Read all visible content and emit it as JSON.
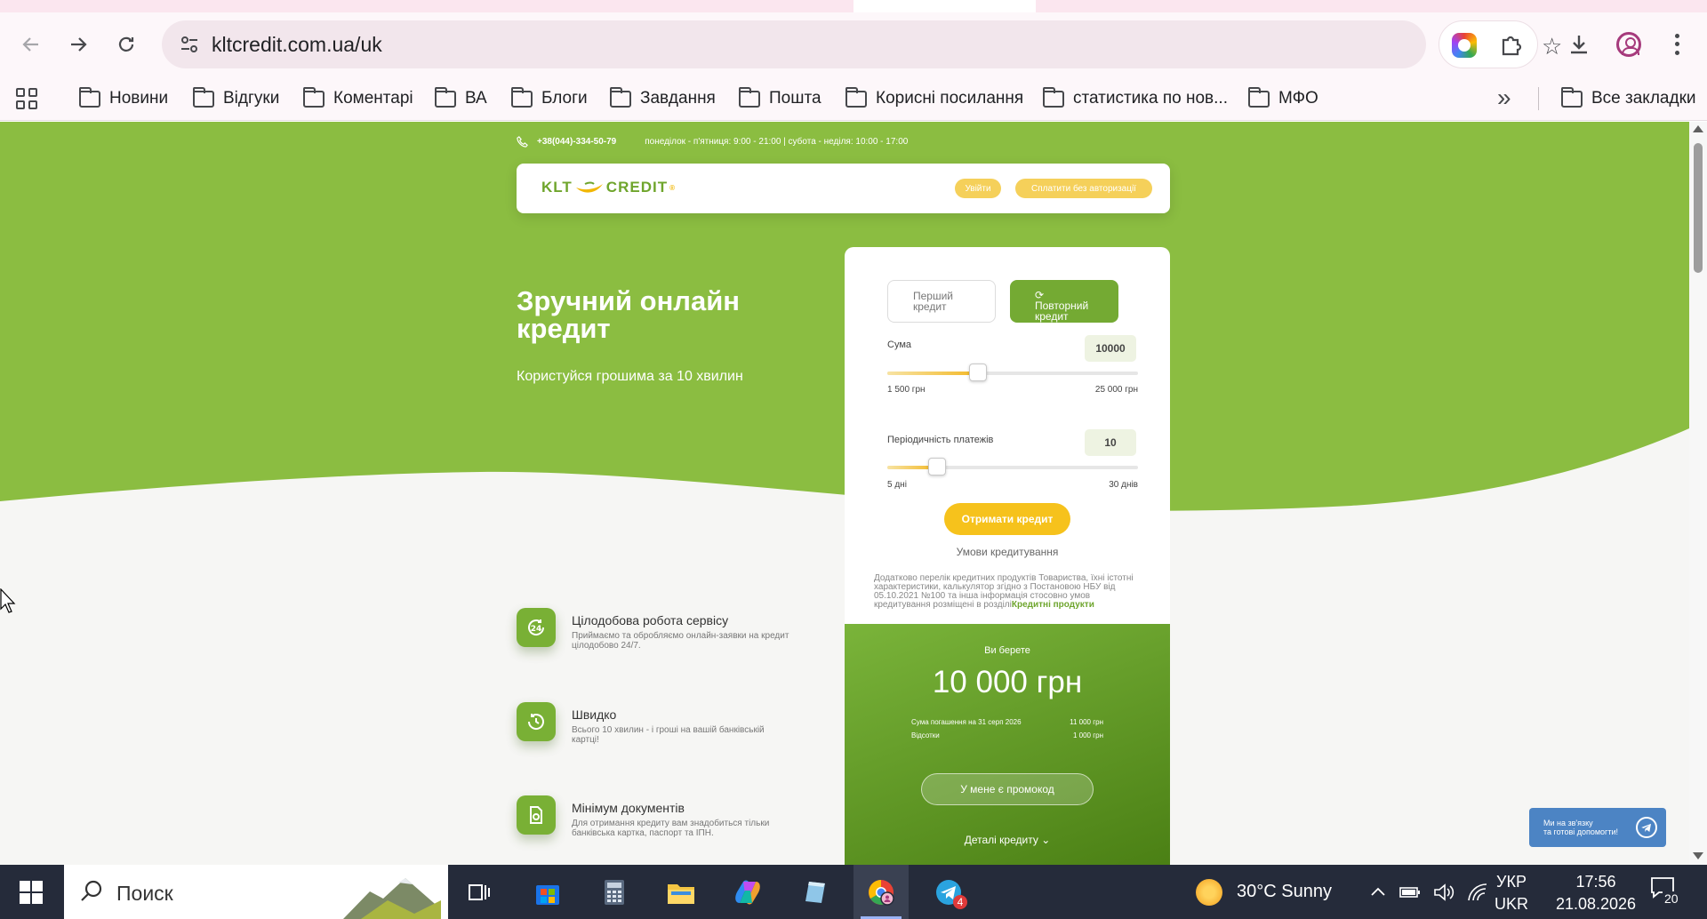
{
  "browser": {
    "url": "kltcredit.com.ua/uk",
    "bookmarks": [
      "Новини",
      "Відгуки",
      "Коментарі",
      "ВА",
      "Блоги",
      "Завдання",
      "Пошта",
      "Корисні посилання",
      "статистика по нов...",
      "МФО"
    ],
    "all_bookmarks_label": "Все закладки"
  },
  "site": {
    "phone": "+38(044)-334-50-79",
    "hours": "понеділок - п'ятниця: 9:00 - 21:00 | субота - неділя: 10:00 - 17:00",
    "logo_left": "KLT",
    "logo_right": "CREDIT",
    "logo_mark": "®",
    "login_label": "Увійти",
    "pay_label": "Сплатити без авторизації",
    "hero_title": "Зручний онлайн кредит",
    "hero_subtitle": "Користуйся грошима за 10 хвилин",
    "features": [
      {
        "title": "Цілодобова робота сервісу",
        "desc": "Приймаємо та обробляємо онлайн-заявки на кредит цілодобово 24/7.",
        "icon": "clock-24-icon"
      },
      {
        "title": "Швидко",
        "desc": "Всього 10 хвилин - і гроші на вашій банківській картці!",
        "icon": "history-clock-icon"
      },
      {
        "title": "Мінімум документів",
        "desc": "Для отримання кредиту вам знадобиться тільки банківська картка, паспорт та ІПН.",
        "icon": "document-icon"
      }
    ]
  },
  "calculator": {
    "tab_first": "Перший кредит",
    "tab_repeat": "Повторний кредит",
    "refresh_glyph": "⟳",
    "amount_label": "Сума",
    "amount_value": "10000",
    "amount_min": "1 500 грн",
    "amount_max": "25 000 грн",
    "amount_fraction": 0.36,
    "period_label": "Періодичність платежів",
    "period_value": "10",
    "period_min": "5 дні",
    "period_max": "30 днів",
    "period_fraction": 0.2,
    "submit_label": "Отримати кредит",
    "terms_link": "Умови кредитування",
    "legal_text": "Додатково перелік кредитних продуктів Товариства, їхні істотні характеристики, калькулятор згідно з Постановою НБУ від 05.10.2021 №100 та інша інформація стосовно умов кредитування розміщені в розділі",
    "legal_link": "Кредитні продукти",
    "summary_label": "Ви берете",
    "summary_amount": "10 000 грн",
    "repay_label": "Сума погашення на 31 серп 2026",
    "repay_value": "11 000 грн",
    "interest_label": "Відсотки",
    "interest_value": "1 000 грн",
    "promo_label": "У мене є промокод",
    "details_label": "Деталі кредиту",
    "details_glyph": "⌄"
  },
  "chat_widget": {
    "line1": "Ми на зв'язку",
    "line2": "та готові допомогти!"
  },
  "taskbar": {
    "search_placeholder": "Поиск",
    "weather": "30°C  Sunny",
    "lang_top": "УКР",
    "lang_bottom": "UKR",
    "time": "17:56",
    "date": "21.08.2026",
    "telegram_badge": "4",
    "notifications_count": "20"
  },
  "colors": {
    "brand_green": "#8bbd41",
    "accent_yellow": "#f6c21c"
  }
}
